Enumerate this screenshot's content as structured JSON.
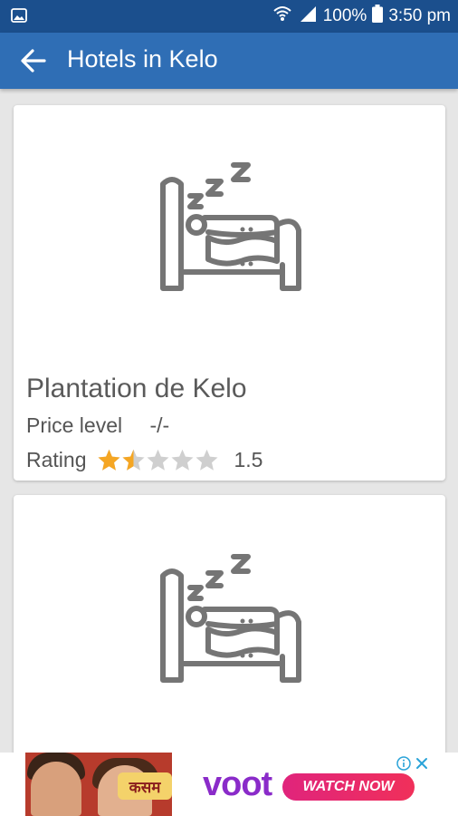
{
  "status_bar": {
    "battery": "100%",
    "time": "3:50 pm"
  },
  "app_bar": {
    "title": "Hotels in Kelo"
  },
  "hotels": [
    {
      "name": "Plantation de Kelo",
      "price_label": "Price level",
      "price_value": "-/-",
      "rating_label": "Rating",
      "rating_value": "1.5",
      "rating": 1.5,
      "rating_max": 5
    },
    {}
  ],
  "ad": {
    "show_title": "कसम",
    "brand": "voot",
    "cta": "WATCH NOW"
  },
  "colors": {
    "status_bar": "#1b4f8d",
    "app_bar": "#2f6eb5",
    "star_filled": "#f5a623",
    "star_empty": "#cfcfcf",
    "icon": "#757575"
  },
  "icons": {
    "back": "arrow-left",
    "hotel": "bed-sleeping",
    "star": "star"
  }
}
